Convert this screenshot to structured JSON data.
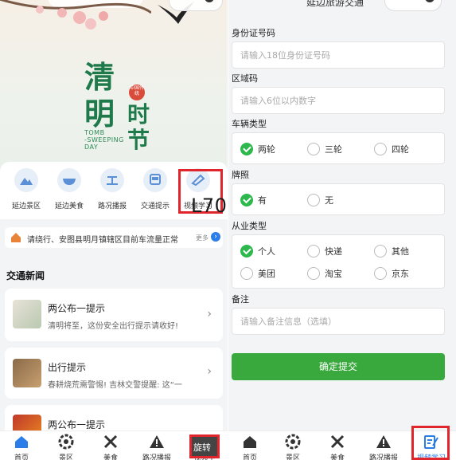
{
  "left": {
    "banner": {
      "title_chars": [
        "清",
        "明",
        "时",
        "节"
      ],
      "seal": "中国传统",
      "english": [
        "TOMB",
        "-SWEEPING",
        "DAY"
      ]
    },
    "nav": [
      {
        "label": "延边景区",
        "icon": "mountain-icon"
      },
      {
        "label": "延边美食",
        "icon": "bowl-icon"
      },
      {
        "label": "路况播报",
        "icon": "road-icon"
      },
      {
        "label": "交通提示",
        "icon": "bus-icon"
      },
      {
        "label": "视频学习",
        "icon": "video-learn-icon"
      }
    ],
    "notice": {
      "text": "请绕行、安图县明月镇辖区目前车流量正常",
      "more": "更多"
    },
    "news_section_title": "交通新闻",
    "news": [
      {
        "title": "两公布一提示",
        "summary": "清明将至，这份安全出行提示请收好!"
      },
      {
        "title": "出行提示",
        "summary": "春耕烧荒需警惕! 吉林交警提醒: 这“一"
      },
      {
        "title": "两公布一提示",
        "summary": ""
      }
    ],
    "watermark": "L70.CN",
    "tabs": [
      {
        "label": "首页",
        "icon": "home-icon"
      },
      {
        "label": "景区",
        "icon": "scenic-icon"
      },
      {
        "label": "美食",
        "icon": "food-icon"
      },
      {
        "label": "路况播报",
        "icon": "warning-icon"
      },
      {
        "label": "视频学",
        "icon": "video-learn-icon"
      }
    ],
    "rotate_label": "旋转"
  },
  "right": {
    "header_title": "延边旅游交通",
    "form": {
      "id_label": "身份证号码",
      "id_placeholder": "请输入18位身份证号码",
      "area_label": "区域码",
      "area_placeholder": "请输入6位以内数字",
      "vehicle_label": "车辆类型",
      "vehicle_options": [
        "两轮",
        "三轮",
        "四轮"
      ],
      "vehicle_selected": "两轮",
      "plate_label": "牌照",
      "plate_options": [
        "有",
        "无"
      ],
      "plate_selected": "有",
      "job_label": "从业类型",
      "job_options": [
        "个人",
        "快递",
        "其他",
        "美团",
        "淘宝",
        "京东"
      ],
      "job_selected": "个人",
      "note_label": "备注",
      "note_placeholder": "请输入备注信息（选填）",
      "submit": "确定提交"
    },
    "tabs": [
      {
        "label": "首页",
        "icon": "home-icon"
      },
      {
        "label": "景区",
        "icon": "scenic-icon"
      },
      {
        "label": "美食",
        "icon": "food-icon"
      },
      {
        "label": "路况播报",
        "icon": "warning-icon"
      },
      {
        "label": "视频学习",
        "icon": "video-learn-icon"
      }
    ]
  },
  "colors": {
    "accent_green": "#3aa93d",
    "title_green": "#1e7a4a",
    "highlight_red": "#e0262c",
    "tab_blue": "#2b7de9"
  }
}
